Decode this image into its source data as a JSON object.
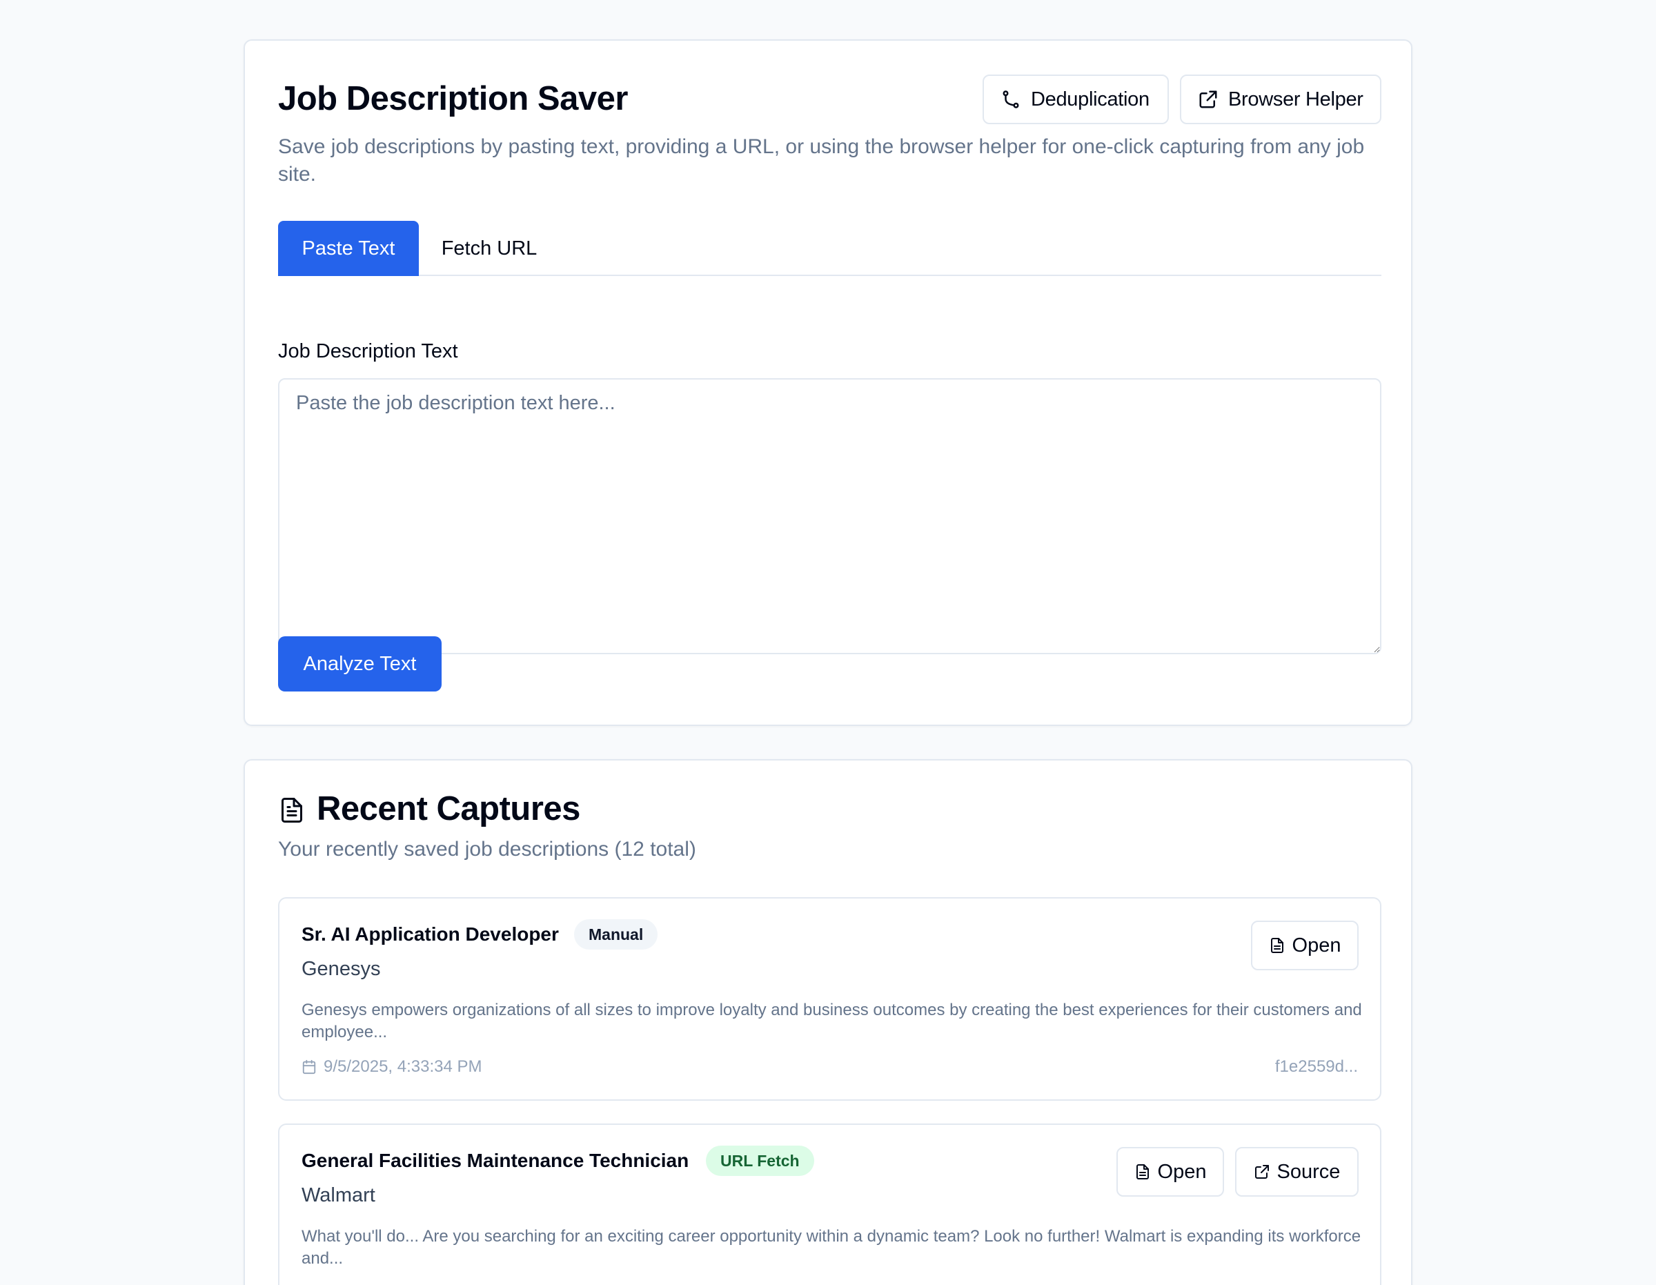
{
  "header": {
    "title": "Job Description Saver",
    "subtitle": "Save job descriptions by pasting text, providing a URL, or using the browser helper for one-click capturing from any job site.",
    "dedup_label": "Deduplication",
    "helper_label": "Browser Helper"
  },
  "tabs": [
    {
      "label": "Paste Text",
      "active": true
    },
    {
      "label": "Fetch URL",
      "active": false
    }
  ],
  "form": {
    "label": "Job Description Text",
    "placeholder": "Paste the job description text here...",
    "value": "",
    "submit_label": "Analyze Text"
  },
  "recent": {
    "title": "Recent Captures",
    "subtitle": "Your recently saved job descriptions (12 total)",
    "items": [
      {
        "title": "Sr. AI Application Developer",
        "badge": "Manual",
        "company": "Genesys",
        "description": "Genesys empowers organizations of all sizes to improve loyalty and business outcomes by creating the best experiences for their customers and employee...",
        "date": "9/5/2025, 4:33:34 PM",
        "id": "f1e2559d...",
        "open_label": "Open"
      },
      {
        "title": "General Facilities Maintenance Technician",
        "badge": "URL Fetch",
        "company": "Walmart",
        "description": "What you'll do... Are you searching for an exciting career opportunity within a dynamic team? Look no further! Walmart is expanding its workforce and...",
        "open_label": "Open",
        "source_label": "Source"
      }
    ]
  },
  "colors": {
    "primary": "#2563eb",
    "muted_text": "#64748b",
    "border": "#e2e8f0",
    "badge_url_bg": "#dcfce7",
    "badge_url_text": "#166534"
  }
}
